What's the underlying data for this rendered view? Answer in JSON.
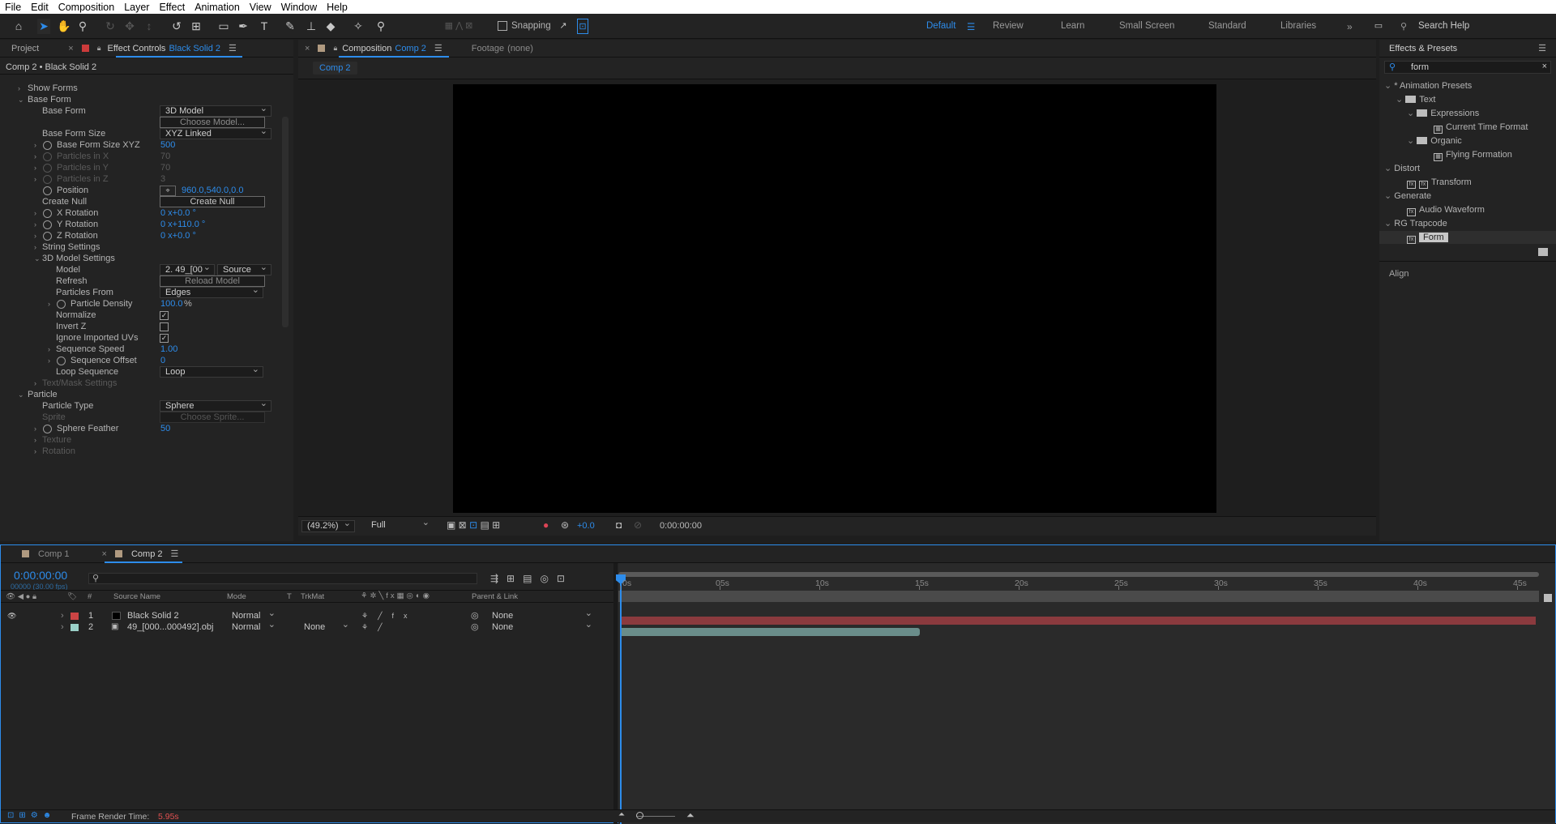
{
  "menu": [
    "File",
    "Edit",
    "Composition",
    "Layer",
    "Effect",
    "Animation",
    "View",
    "Window",
    "Help"
  ],
  "toolbar": {
    "snapping": "Snapping",
    "workspaces": [
      "Default",
      "Review",
      "Learn",
      "Small Screen",
      "Standard",
      "Libraries"
    ],
    "search_help": "Search Help"
  },
  "project_tab": "Project",
  "effect_controls": {
    "tab_label": "Effect Controls",
    "layer": "Black Solid 2",
    "breadcrumb": "Comp 2 • Black Solid 2",
    "rows": {
      "show_forms": "Show Forms",
      "base_form": "Base Form",
      "base_form_lbl": "Base Form",
      "base_form_val": "3D Model",
      "choose_model": "Choose Model...",
      "base_form_size": "Base Form Size",
      "base_form_size_val": "XYZ Linked",
      "size_xyz": "Base Form Size XYZ",
      "size_xyz_val": "500",
      "px": "Particles in X",
      "px_val": "70",
      "py": "Particles in Y",
      "py_val": "70",
      "pz": "Particles in Z",
      "pz_val": "3",
      "position": "Position",
      "position_val": "960.0,540.0,0.0",
      "create_null_lbl": "Create Null",
      "create_null_btn": "Create Null",
      "xrot": "X Rotation",
      "xrot_val": "0 x+0.0 °",
      "yrot": "Y Rotation",
      "yrot_val": "0 x+110.0 °",
      "zrot": "Z Rotation",
      "zrot_val": "0 x+0.0 °",
      "string": "String Settings",
      "model_settings": "3D Model Settings",
      "model": "Model",
      "model_val": "2. 49_[00",
      "model_src": "Source",
      "refresh": "Refresh",
      "reload": "Reload Model",
      "particles_from": "Particles From",
      "particles_from_val": "Edges",
      "density": "Particle Density",
      "density_val": "100.0",
      "density_unit": "%",
      "normalize": "Normalize",
      "invert_z": "Invert Z",
      "ignore_uv": "Ignore Imported UVs",
      "seq_speed": "Sequence Speed",
      "seq_speed_val": "1.00",
      "seq_offset": "Sequence Offset",
      "seq_offset_val": "0",
      "loop_seq": "Loop Sequence",
      "loop_val": "Loop",
      "text_mask": "Text/Mask Settings",
      "particle": "Particle",
      "ptype": "Particle Type",
      "ptype_val": "Sphere",
      "sprite": "Sprite",
      "choose_sprite": "Choose Sprite...",
      "feather": "Sphere Feather",
      "feather_val": "50",
      "texture": "Texture",
      "rotation": "Rotation"
    }
  },
  "composition": {
    "tab_prefix": "Composition",
    "name": "Comp 2",
    "footage": "Footage",
    "footage_val": "(none)",
    "crumb": "Comp 2",
    "zoom": "(49.2%)",
    "res": "Full",
    "exposure": "+0.0",
    "timecode": "0:00:00:00"
  },
  "effects_presets": {
    "title": "Effects & Presets",
    "search": "form",
    "tree": [
      "* Animation Presets",
      "Text",
      "Expressions",
      "Current Time Format",
      "Organic",
      "Flying Formation",
      "Distort",
      "Transform",
      "Generate",
      "Audio Waveform",
      "RG Trapcode",
      "Form"
    ],
    "align": "Align"
  },
  "timeline": {
    "tabs": [
      "Comp 1",
      "Comp 2"
    ],
    "timecode": "0:00:00:00",
    "fps": "00000 (30.00 fps)",
    "cols": {
      "num": "#",
      "source": "Source Name",
      "mode": "Mode",
      "t": "T",
      "trkmat": "TrkMat",
      "parent": "Parent & Link"
    },
    "layers": [
      {
        "num": "1",
        "name": "Black Solid 2",
        "mode": "Normal",
        "trkmat": "",
        "parent": "None",
        "color": "#cc4444"
      },
      {
        "num": "2",
        "name": "49_[000...000492].obj",
        "mode": "Normal",
        "trkmat": "None",
        "parent": "None",
        "color": "#9ad0c8"
      }
    ],
    "ruler": [
      "0s",
      "05s",
      "10s",
      "15s",
      "20s",
      "25s",
      "30s",
      "35s",
      "40s",
      "45s"
    ],
    "render_label": "Frame Render Time:",
    "render_val": "5.95s"
  }
}
